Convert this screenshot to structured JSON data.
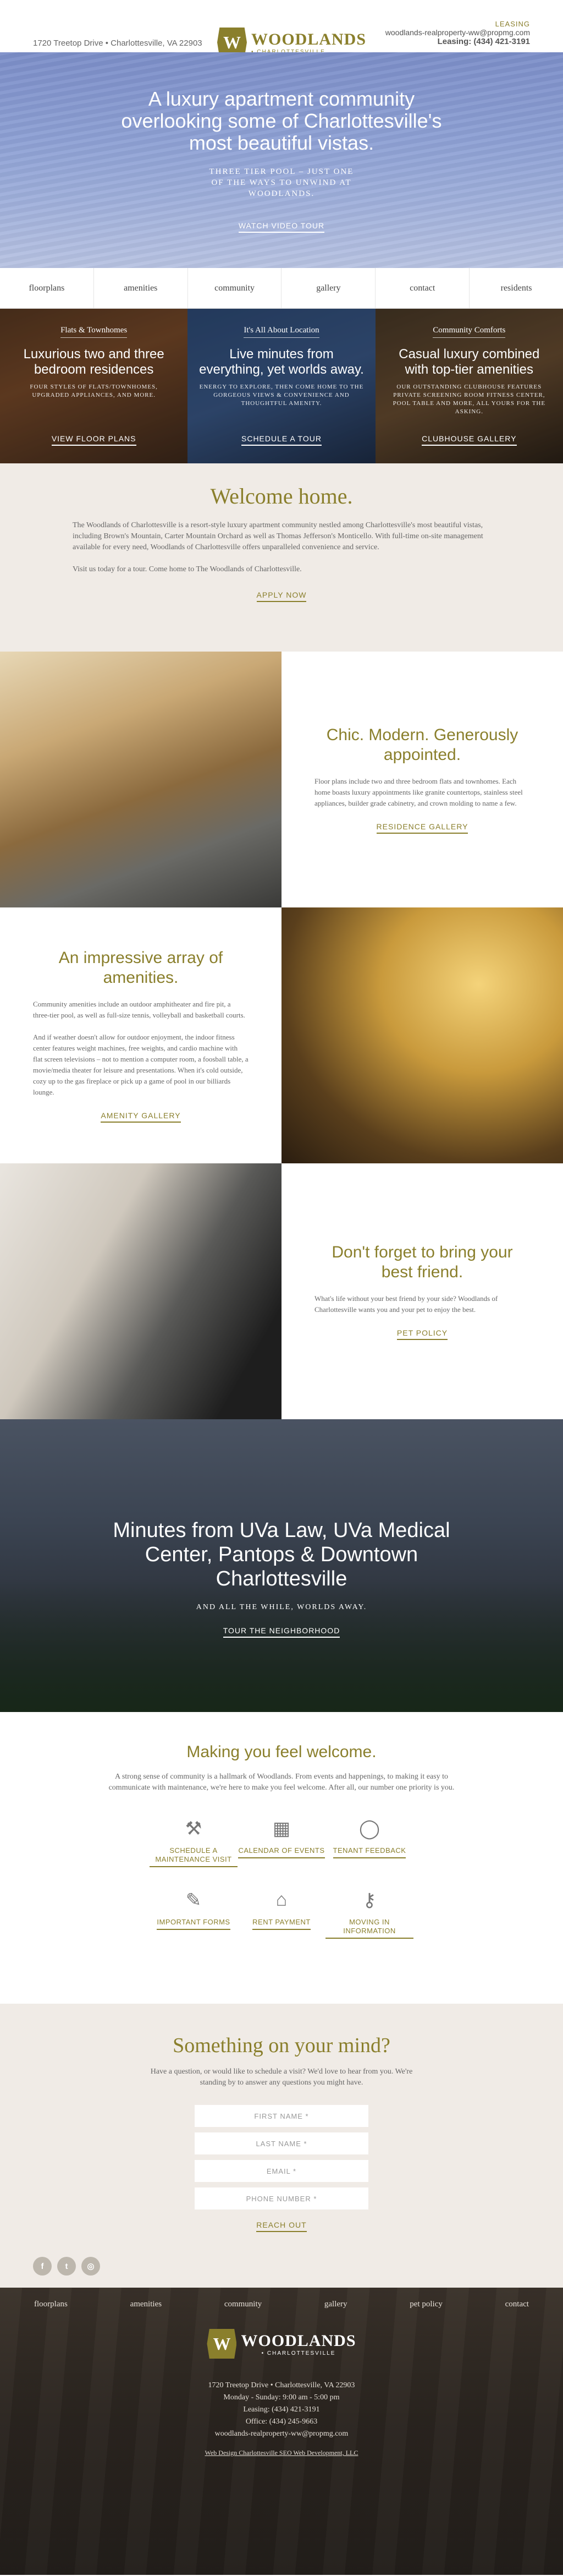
{
  "header": {
    "address": "1720 Treetop Drive • Charlottesville, VA 22903",
    "logo_letter": "W",
    "logo_name": "WOODLANDS",
    "logo_sub": "• CHARLOTTESVILLE",
    "leasing_label": "LEASING",
    "email": "woodlands-realproperty-ww@propmg.com",
    "phone": "Leasing: (434) 421-3191"
  },
  "hero": {
    "title": "A luxury apartment community overlooking some of Charlottesville's most beautiful vistas.",
    "tagline": "THREE TIER POOL – JUST ONE OF THE WAYS TO UNWIND AT WOODLANDS.",
    "cta": "WATCH VIDEO TOUR"
  },
  "nav": [
    "floorplans",
    "amenities",
    "community",
    "gallery",
    "contact",
    "residents"
  ],
  "tiles": [
    {
      "kicker": "Flats & Townhomes",
      "title": "Luxurious two and three bedroom residences",
      "text": "FOUR STYLES OF FLATS/TOWNHOMES, UPGRADED APPLIANCES, AND MORE.",
      "cta": "VIEW FLOOR PLANS"
    },
    {
      "kicker": "It's All About Location",
      "title": "Live minutes from everything, yet worlds away.",
      "text": "ENERGY TO EXPLORE, THEN COME HOME TO THE GORGEOUS VIEWS & CONVENIENCE AND THOUGHTFUL AMENITY.",
      "cta": "SCHEDULE A TOUR"
    },
    {
      "kicker": "Community Comforts",
      "title": "Casual luxury combined with top-tier amenities",
      "text": "OUR OUTSTANDING CLUBHOUSE FEATURES PRIVATE SCREENING ROOM FITNESS CENTER, POOL TABLE AND MORE, ALL YOURS FOR THE ASKING.",
      "cta": "CLUBHOUSE GALLERY"
    }
  ],
  "welcome": {
    "title": "Welcome home.",
    "body": "The Woodlands of Charlottesville is a resort-style luxury apartment community nestled among Charlottesville's most beautiful vistas, including Brown's Mountain, Carter Mountain Orchard as well as Thomas Jefferson's Monticello. With full-time on-site management available for every need, Woodlands of Charlottesville offers unparalleled convenience and service.",
    "body2": "Visit us today for a tour. Come home to The Woodlands of Charlottesville.",
    "cta": "APPLY NOW"
  },
  "residences": {
    "title": "Chic. Modern. Generously appointed.",
    "body": "Floor plans include two and three bedroom flats and townhomes. Each home boasts luxury appointments like granite countertops, stainless steel appliances, builder grade cabinetry, and crown molding to name a few.",
    "cta": "RESIDENCE GALLERY"
  },
  "amenities": {
    "title": "An impressive array of amenities.",
    "body": "Community amenities include an outdoor amphitheater and fire pit, a three-tier pool, as well as full-size tennis, volleyball and basketball courts.",
    "body2": "And if weather doesn't allow for outdoor enjoyment, the indoor fitness center features weight machines, free weights, and cardio machine with flat screen televisions – not to mention a computer room, a foosball table, a movie/media theater for leisure and presentations. When it's cold outside, cozy up to the gas fireplace or pick up a game of pool in our billiards lounge.",
    "cta": "AMENITY GALLERY"
  },
  "pets": {
    "title": "Don't forget to bring your best friend.",
    "body": "What's life without your best friend by your side? Woodlands of Charlottesville wants you and your pet to enjoy the best.",
    "cta": "PET POLICY"
  },
  "town": {
    "title": "Minutes from UVa Law, UVa Medical Center, Pantops & Downtown Charlottesville",
    "tagline": "AND ALL THE WHILE, WORLDS AWAY.",
    "cta": "TOUR THE NEIGHBORHOOD"
  },
  "feel": {
    "title": "Making you feel welcome.",
    "body": "A strong sense of community is a hallmark of Woodlands. From events and happenings, to making it easy to communicate with maintenance, we're here to make you feel welcome. After all, our number one priority is you.",
    "items": [
      {
        "icon": "tools-icon",
        "glyph": "⚒",
        "label": "SCHEDULE A MAINTENANCE VISIT"
      },
      {
        "icon": "calendar-icon",
        "glyph": "▦",
        "label": "CALENDAR OF EVENTS"
      },
      {
        "icon": "speech-bubble-icon",
        "glyph": "◯",
        "label": "TENANT FEEDBACK"
      },
      {
        "icon": "document-icon",
        "glyph": "✎",
        "label": "IMPORTANT FORMS"
      },
      {
        "icon": "house-dollar-icon",
        "glyph": "⌂",
        "label": "RENT PAYMENT"
      },
      {
        "icon": "key-icon",
        "glyph": "⚷",
        "label": "MOVING IN INFORMATION"
      }
    ]
  },
  "contact": {
    "title": "Something on your mind?",
    "body": "Have a question, or would like to schedule a visit? We'd love to hear from you. We're standing by to answer any questions you might have.",
    "first_name": "FIRST NAME *",
    "last_name": "LAST NAME *",
    "email": "EMAIL *",
    "phone": "PHONE NUMBER *",
    "cta": "REACH OUT"
  },
  "social": {
    "facebook": "f",
    "twitter": "t",
    "instagram": "◎"
  },
  "footer": {
    "nav": [
      "floorplans",
      "amenities",
      "community",
      "gallery",
      "pet policy",
      "contact"
    ],
    "address": "1720 Treetop Drive • Charlottesville, VA 22903",
    "hours": "Monday - Sunday: 9:00 am - 5:00 pm",
    "leasing": "Leasing: (434) 421-3191",
    "office": "Office: (434) 245-9663",
    "email": "woodlands-realproperty-ww@propmg.com",
    "credit": "Web Design Charlottesville SEO Web Development, LLC"
  },
  "colors": {
    "accent": "#8a7f2c",
    "cream": "#f0ebe6"
  }
}
